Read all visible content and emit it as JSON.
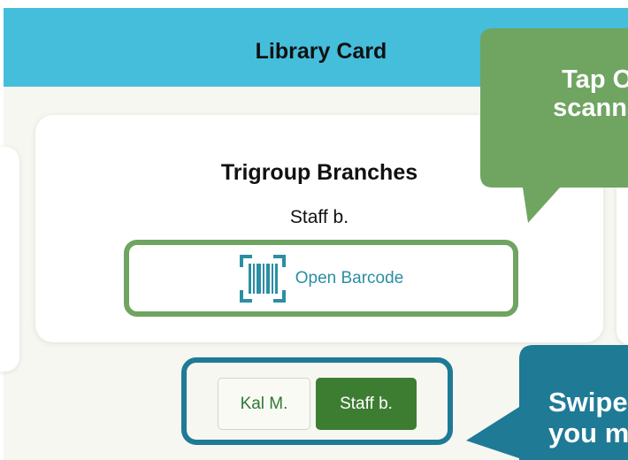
{
  "header": {
    "title": "Library Card"
  },
  "card": {
    "branch_name": "Trigroup Branches",
    "card_holder": "Staff b.",
    "open_barcode_label": "Open Barcode"
  },
  "card_switcher": {
    "options": [
      {
        "label": "Kal M.",
        "selected": false
      },
      {
        "label": "Staff b.",
        "selected": true
      }
    ]
  },
  "tips": {
    "green": {
      "line1": "Tap Op",
      "line2": "scannab"
    },
    "blue": {
      "line1": "Swipe",
      "line2": "you m"
    }
  },
  "colors": {
    "header_bg": "#45bedb",
    "page_bg": "#f7f7f2",
    "highlight_green": "#6fa461",
    "highlight_blue": "#1f7a96",
    "tip_green": "#6fa461",
    "tip_blue": "#1f7a96",
    "segment_active": "#3d7d32",
    "link_text": "#2b8ea4"
  },
  "icons": {
    "open_barcode": "barcode-scan-icon"
  }
}
